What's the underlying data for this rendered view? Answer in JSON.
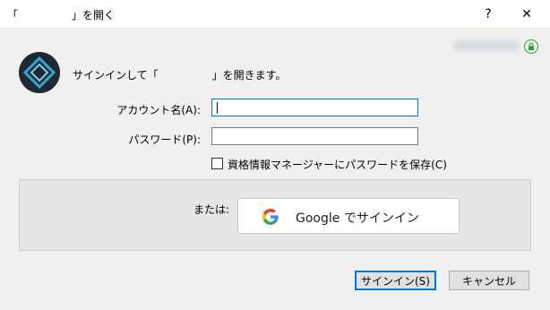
{
  "window": {
    "title": "「　　　　　」を開く",
    "help_label": "?",
    "close_label": "✕"
  },
  "header": {
    "signin_message": "サインインして「　　　　　」を開きます。"
  },
  "form": {
    "account_label": "アカウント名(A):",
    "password_label": "パスワード(P):",
    "save_password_label": "資格情報マネージャーにパスワードを保存(C)",
    "save_password_checked": false
  },
  "alt_signin": {
    "or_label": "または:",
    "google_button_label": "Google でサインイン"
  },
  "buttons": {
    "signin_label": "サインイン(S)",
    "cancel_label": "キャンセル"
  },
  "colors": {
    "accent": "#0078d7",
    "lock_green": "#3a9b3a",
    "logo_bg": "#1f2a33",
    "logo_teal": "#2ea8d8"
  }
}
